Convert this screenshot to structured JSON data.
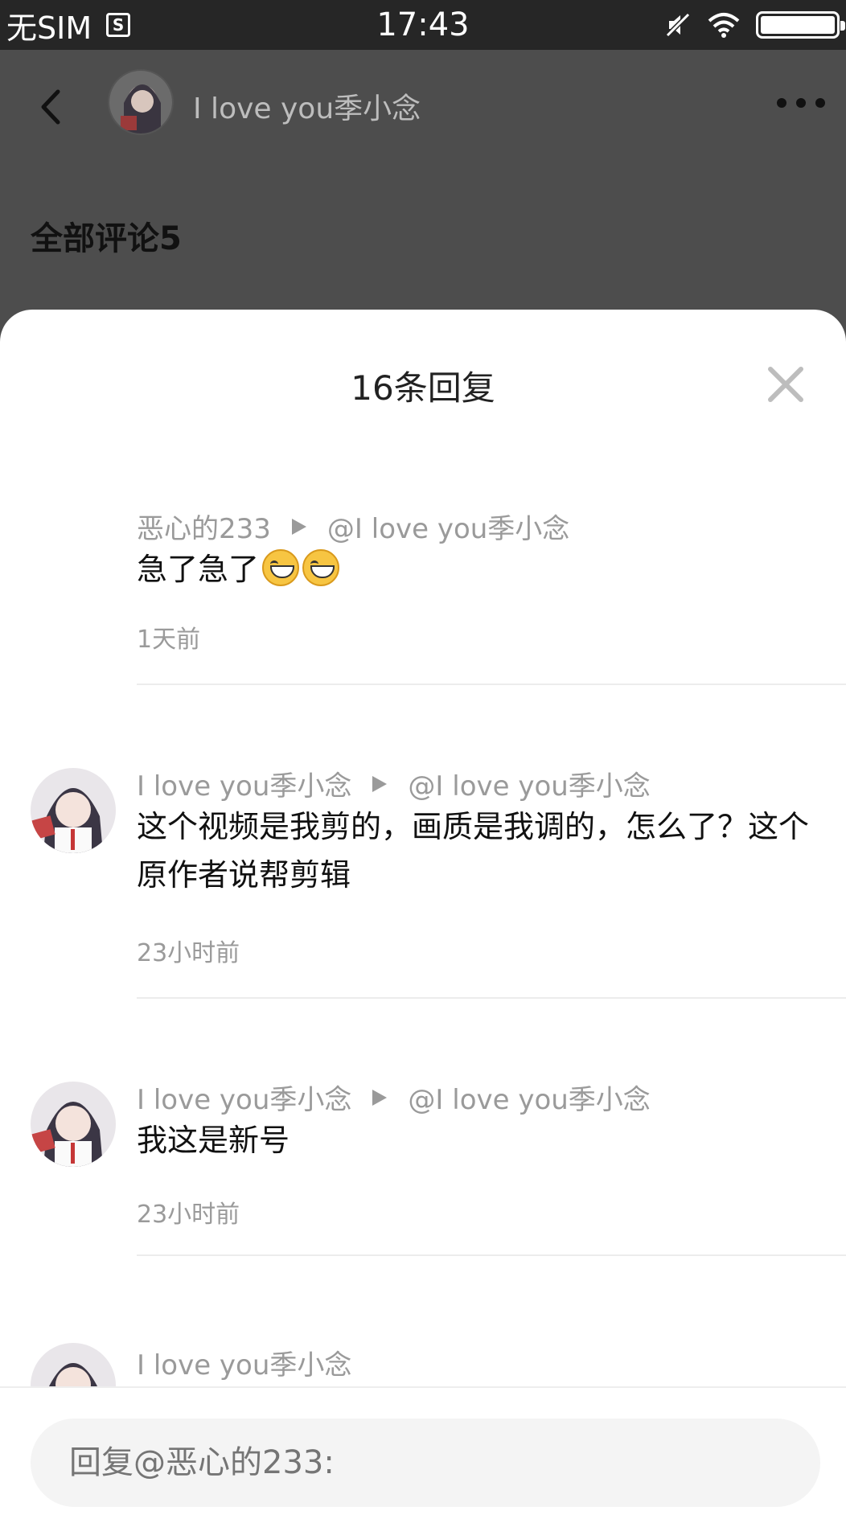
{
  "status_bar": {
    "carrier": "无SIM",
    "time": "17:43",
    "battery_level": 1.0
  },
  "nav": {
    "title": "I love you季小念"
  },
  "section": {
    "title": "全部评论5"
  },
  "sheet": {
    "title": "16条回复",
    "replies": [
      {
        "author": "恶心的233",
        "target": "@I love you季小念",
        "content": "急了急了",
        "emojis": [
          "grinning-face-icon",
          "grinning-face-icon"
        ],
        "time": "1天前",
        "has_avatar": false
      },
      {
        "author": "I love you季小念",
        "target": "@I love you季小念",
        "content": "这个视频是我剪的，画质是我调的，怎么了？这个原作者说帮剪辑",
        "time": "23小时前",
        "has_avatar": true
      },
      {
        "author": "I love you季小念",
        "target": "@I love you季小念",
        "content": "我这是新号",
        "time": "23小时前",
        "has_avatar": true
      },
      {
        "author": "I love you季小念",
        "has_avatar": true
      }
    ]
  },
  "input": {
    "placeholder": "回复@恶心的233:"
  },
  "colors": {
    "accent_text": "#9a9a9a",
    "overlay": "#4d4d4d",
    "sheet_bg": "#ffffff"
  }
}
